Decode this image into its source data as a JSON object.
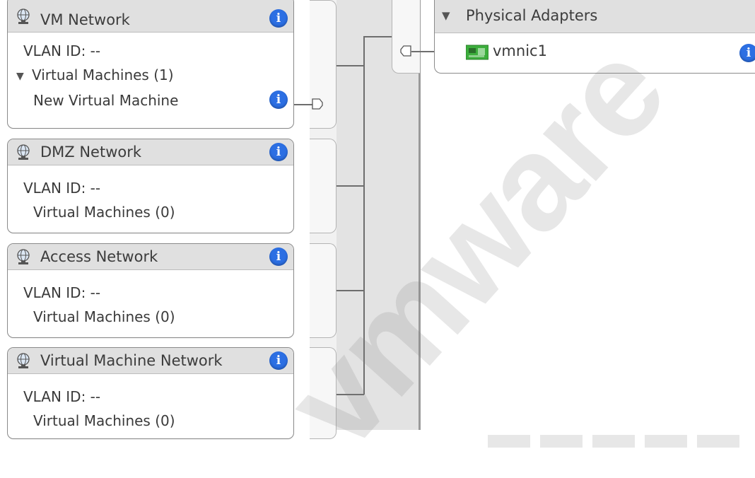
{
  "watermark_text": "vmware",
  "colors": {
    "info_blue": "#2c6fe3",
    "header_gray": "#e0e0e0",
    "nic_green": "#3cae3c"
  },
  "port_groups": [
    {
      "name": "VM Network",
      "vlan": "VLAN ID: --",
      "vms_label": "Virtual Machines (1)",
      "expanded": true,
      "vms": [
        "New Virtual Machine"
      ]
    },
    {
      "name": "DMZ Network",
      "vlan": "VLAN ID: --",
      "vms_label": "Virtual Machines (0)",
      "expanded": false,
      "vms": []
    },
    {
      "name": "Access Network",
      "vlan": "VLAN ID: --",
      "vms_label": "Virtual Machines (0)",
      "expanded": false,
      "vms": []
    },
    {
      "name": "Virtual Machine Network",
      "vlan": "VLAN ID: --",
      "vms_label": "Virtual Machines (0)",
      "expanded": false,
      "vms": []
    }
  ],
  "physical_adapters": {
    "title": "Physical Adapters",
    "adapters": [
      {
        "name": "vmnic1"
      }
    ]
  },
  "icons": {
    "port_group": "network-globe-icon",
    "info": "info-icon",
    "nic": "nic-card-icon",
    "expand": "triangle-down-icon"
  }
}
